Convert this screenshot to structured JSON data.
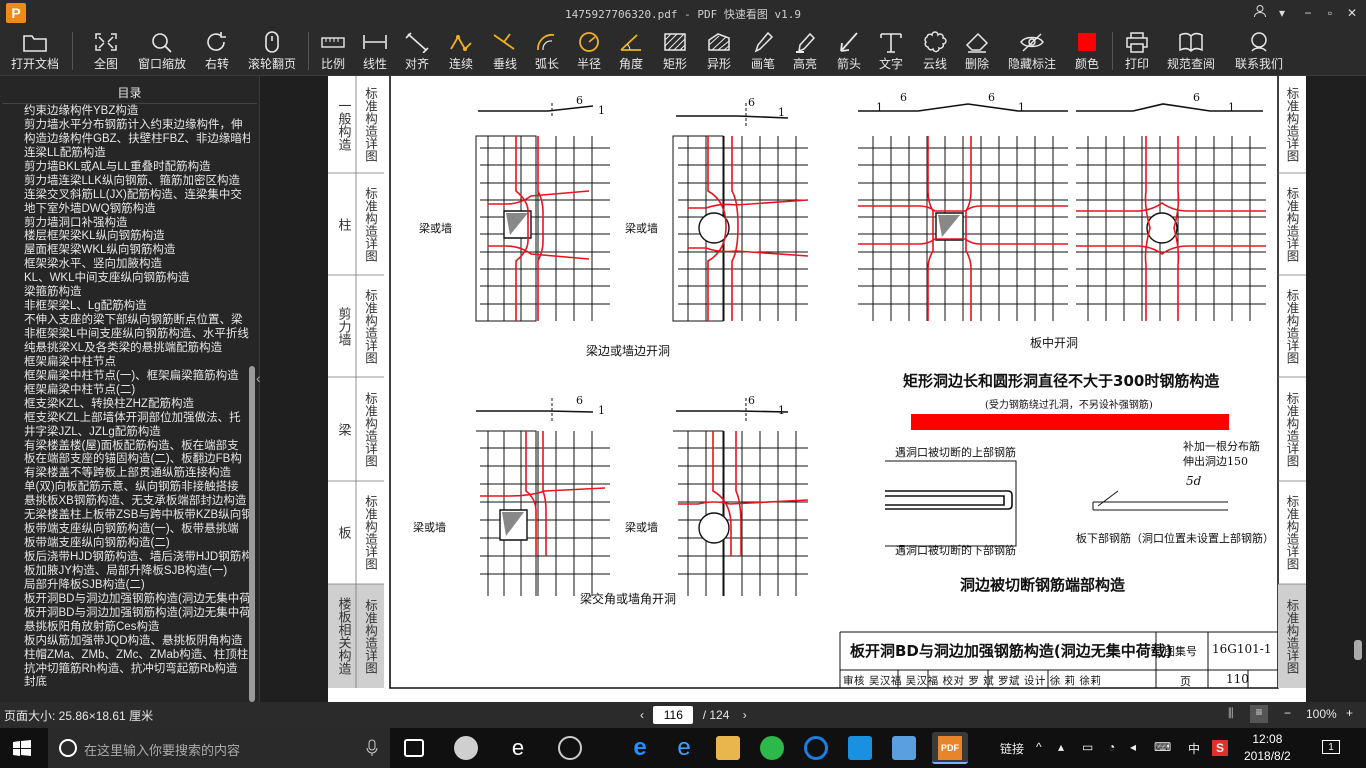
{
  "window": {
    "title": "1475927706320.pdf - PDF 快速看图 v1.9",
    "logo": "P"
  },
  "toolbar": {
    "items": [
      {
        "label": "打开文档",
        "icon": "folder-icon"
      },
      {
        "label": "全图",
        "icon": "fit-icon"
      },
      {
        "label": "窗口缩放",
        "icon": "zoom-icon"
      },
      {
        "label": "右转",
        "icon": "rotate-icon"
      },
      {
        "label": "滚轮翻页",
        "icon": "mouse-icon"
      },
      {
        "label": "比例",
        "icon": "scale-icon"
      },
      {
        "label": "线性",
        "icon": "linear-icon"
      },
      {
        "label": "对齐",
        "icon": "align-icon"
      },
      {
        "label": "连续",
        "icon": "continuous-icon"
      },
      {
        "label": "垂线",
        "icon": "perpendicular-icon"
      },
      {
        "label": "弧长",
        "icon": "arc-icon"
      },
      {
        "label": "半径",
        "icon": "radius-icon"
      },
      {
        "label": "角度",
        "icon": "angle-icon"
      },
      {
        "label": "矩形",
        "icon": "rectangle-icon"
      },
      {
        "label": "异形",
        "icon": "polygon-icon"
      },
      {
        "label": "画笔",
        "icon": "pen-icon"
      },
      {
        "label": "高亮",
        "icon": "highlight-icon"
      },
      {
        "label": "箭头",
        "icon": "arrow-icon"
      },
      {
        "label": "文字",
        "icon": "text-icon"
      },
      {
        "label": "云线",
        "icon": "cloud-icon"
      },
      {
        "label": "删除",
        "icon": "eraser-icon"
      },
      {
        "label": "隐藏标注",
        "icon": "hide-icon"
      },
      {
        "label": "颜色",
        "icon": "color-icon"
      },
      {
        "label": "打印",
        "icon": "print-icon"
      },
      {
        "label": "规范查阅",
        "icon": "book-icon"
      },
      {
        "label": "联系我们",
        "icon": "contact-icon"
      }
    ],
    "color_swatch": "#ff0000"
  },
  "sidebar": {
    "heading": "目录",
    "items": [
      "约束边缘构件YBZ构造",
      "剪力墙水平分布钢筋计入约束边缘构件，伸",
      "构造边缘构件GBZ、扶壁柱FBZ、非边缘暗柱",
      "连梁LL配筋构造",
      "剪力墙BKL或AL与LL重叠时配筋构造",
      "剪力墙连梁LLK纵向钢筋、箍筋加密区构造",
      "连梁交叉斜筋LL(JX)配筋构造、连梁集中交",
      "地下室外墙DWQ钢筋构造",
      "剪力墙洞口补强构造",
      "楼层框架梁KL纵向钢筋构造",
      "屋面框架梁WKL纵向钢筋构造",
      "框架梁水平、竖向加腋构造",
      "KL、WKL中间支座纵向钢筋构造",
      "梁箍筋构造",
      "非框架梁L、Lg配筋构造",
      "不伸入支座的梁下部纵向钢筋断点位置、梁",
      "非框架梁L中间支座纵向钢筋构造、水平折线",
      "纯悬挑梁XL及各类梁的悬挑端配筋构造",
      "框架扁梁中柱节点",
      "框架扁梁中柱节点(一)、框架扁梁箍筋构造",
      "框架扁梁中柱节点(二)",
      "框支梁KZL、转换柱ZHZ配筋构造",
      "框支梁KZL上部墙体开洞部位加强做法、托",
      "井字梁JZL、JZLg配筋构造",
      "有梁楼盖楼(屋)面板配筋构造、板在端部支",
      "板在端部支座的锚固构造(二)、板翻边FB构",
      "有梁楼盖不等跨板上部贯通纵筋连接构造",
      "单(双)向板配筋示意、纵向钢筋非接触搭接",
      "悬挑板XB钢筋构造、无支承板端部封边构造",
      "无梁楼盖柱上板带ZSB与跨中板带KZB纵向钢",
      "板带端支座纵向钢筋构造(一)、板带悬挑端",
      "板带端支座纵向钢筋构造(二)",
      "板后浇带HJD钢筋构造、墙后浇带HJD钢筋构",
      "板加腋JY构造、局部升降板SJB构造(一)",
      "局部升降板SJB构造(二)",
      "板开洞BD与洞边加强钢筋构造(洞边无集中荷",
      "板开洞BD与洞边加强钢筋构造(洞边无集中荷",
      "悬挑板阳角放射筋Ces构造",
      "板内纵筋加强带JQD构造、悬挑板阴角构造",
      "柱帽ZMa、ZMb、ZMc、ZMab构造、柱顶柱帽",
      "抗冲切箍筋Rh构造、抗冲切弯起筋Rb构造",
      "封底"
    ]
  },
  "document": {
    "left_tabs": [
      {
        "main": "一般构造",
        "sub": "标准构造详图"
      },
      {
        "main": "柱",
        "sub": "标准构造详图"
      },
      {
        "main": "剪力墙",
        "sub": "标准构造详图"
      },
      {
        "main": "梁",
        "sub": "标准构造详图"
      },
      {
        "main": "板",
        "sub": "标准构造详图"
      },
      {
        "main": "楼板相关构造",
        "sub": "标准构造详图"
      }
    ],
    "right_tabs": [
      "标准构造详图",
      "标准构造详图",
      "标准构造详图",
      "标准构造详图",
      "标准构造详图",
      "标准构造详图"
    ],
    "beam_or_wall": "梁或墙",
    "slope_6": "6",
    "slope_1": "1",
    "caption_edge": "梁边或墙边开洞",
    "caption_middle": "板中开洞",
    "caption_corner": "梁交角或墙角开洞",
    "heading_rect": "矩形洞边长和圆形洞直径不大于300时钢筋构造",
    "note_rect": "(受力钢筋绕过孔洞，不另设补强钢筋)",
    "cut_top": "遇洞口被切断的上部钢筋",
    "cut_bottom": "遇洞口被切断的下部钢筋",
    "extra_bar_1": "补加一根分布筋",
    "extra_bar_2": "伸出洞边150",
    "five_d": "5d",
    "bottom_bar": "板下部钢筋（洞口位置未设置上部钢筋）",
    "heading_end": "洞边被切断钢筋端部构造",
    "title_block": {
      "title": "板开洞BD与洞边加强钢筋构造(洞边无集中荷载)",
      "atlas_label": "图集号",
      "atlas_no": "16G101-1",
      "review": "审核 吴汉福 吴汉福 校对 罗 斌 罗斌 设计 徐 莉 徐莉",
      "page_label": "页",
      "page_no": "110"
    }
  },
  "status": {
    "page_size": "页面大小: 25.86×18.61 厘米",
    "current_page": "116",
    "total_pages": "/ 124",
    "zoom": "100%"
  },
  "taskbar": {
    "search_placeholder": "在这里输入你要搜索的内容",
    "link_label": "链接",
    "ime": "中",
    "time": "12:08",
    "date": "2018/8/2"
  }
}
